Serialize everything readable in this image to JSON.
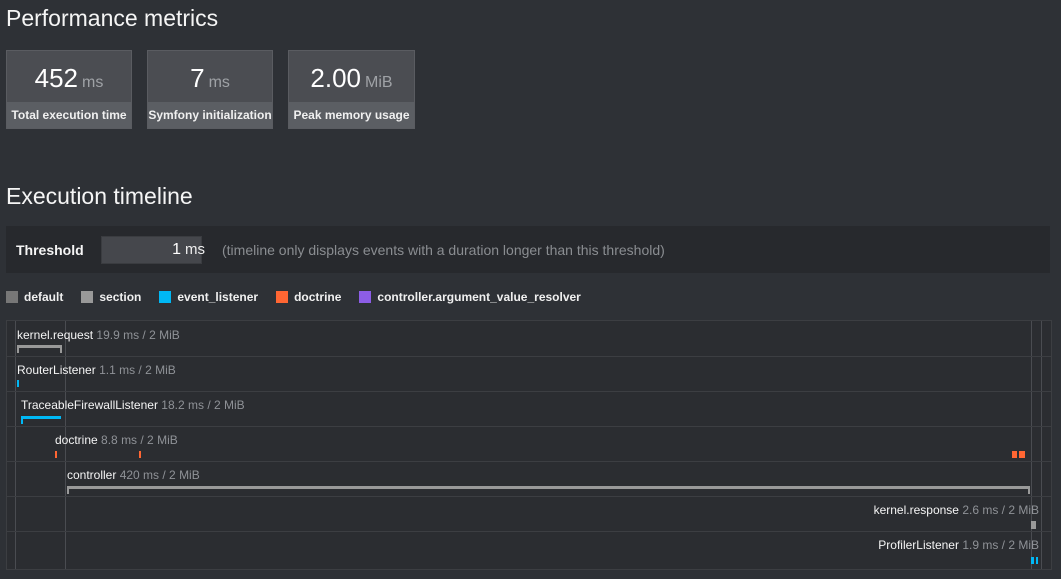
{
  "headings": {
    "performance": "Performance metrics",
    "timeline": "Execution timeline"
  },
  "metrics": [
    {
      "value": "452",
      "unit": "ms",
      "label": "Total execution time"
    },
    {
      "value": "7",
      "unit": "ms",
      "label": "Symfony initialization"
    },
    {
      "value": "2.00",
      "unit": "MiB",
      "label": "Peak memory usage"
    }
  ],
  "threshold": {
    "label": "Threshold",
    "value": "1",
    "unit": "ms",
    "help": "(timeline only displays events with a duration longer than this threshold)"
  },
  "legend": [
    {
      "name": "default",
      "color": "#777777"
    },
    {
      "name": "section",
      "color": "#999999"
    },
    {
      "name": "event_listener",
      "color": "#00b8f5"
    },
    {
      "name": "doctrine",
      "color": "#ff6633"
    },
    {
      "name": "controller.argument_value_resolver",
      "color": "#8c5de6"
    }
  ],
  "events": [
    {
      "name": "kernel.request",
      "duration": "19.9 ms / 2 MiB",
      "category": "section"
    },
    {
      "name": "RouterListener",
      "duration": "1.1 ms / 2 MiB",
      "category": "event_listener"
    },
    {
      "name": "TraceableFirewallListener",
      "duration": "18.2 ms / 2 MiB",
      "category": "event_listener"
    },
    {
      "name": "doctrine",
      "duration": "8.8 ms / 2 MiB",
      "category": "doctrine"
    },
    {
      "name": "controller",
      "duration": "420 ms / 2 MiB",
      "category": "section"
    },
    {
      "name": "kernel.response",
      "duration": "2.6 ms / 2 MiB",
      "category": "section"
    },
    {
      "name": "ProfilerListener",
      "duration": "1.9 ms / 2 MiB",
      "category": "event_listener"
    }
  ]
}
